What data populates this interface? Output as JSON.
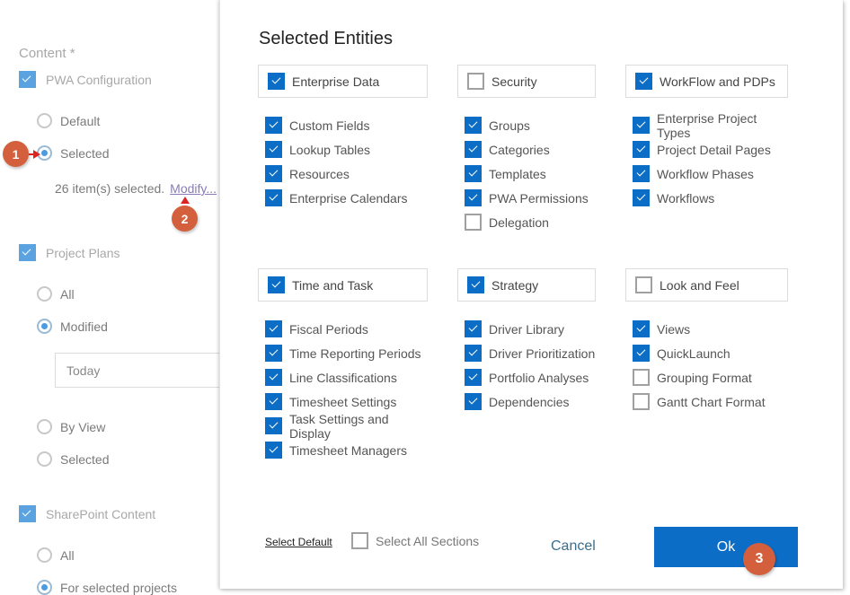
{
  "background": {
    "content_label": "Content *",
    "pwa_configuration": {
      "label": "PWA Configuration",
      "checked": true
    },
    "pwa_options": [
      {
        "label": "Default",
        "selected": false
      },
      {
        "label": "Selected",
        "selected": true
      }
    ],
    "items_selected_text": "26 item(s) selected.",
    "modify_link": "Modify...",
    "project_plans": {
      "label": "Project Plans",
      "checked": true
    },
    "project_options": [
      {
        "label": "All",
        "selected": false
      },
      {
        "label": "Modified",
        "selected": true
      }
    ],
    "modified_date_value": "Today",
    "project_options_more": [
      {
        "label": "By View",
        "selected": false
      },
      {
        "label": "Selected",
        "selected": false
      }
    ],
    "sharepoint_content": {
      "label": "SharePoint Content",
      "checked": true
    },
    "sharepoint_options": [
      {
        "label": "All",
        "selected": false
      },
      {
        "label": "For selected projects",
        "selected": true
      }
    ]
  },
  "callouts": [
    "1",
    "2",
    "3"
  ],
  "dialog": {
    "title": "Selected Entities",
    "groups": [
      {
        "label": "Enterprise Data",
        "checked": true,
        "items": [
          {
            "label": "Custom Fields",
            "checked": true
          },
          {
            "label": "Lookup Tables",
            "checked": true
          },
          {
            "label": "Resources",
            "checked": true
          },
          {
            "label": "Enterprise Calendars",
            "checked": true
          }
        ]
      },
      {
        "label": "Security",
        "checked": false,
        "items": [
          {
            "label": "Groups",
            "checked": true
          },
          {
            "label": "Categories",
            "checked": true
          },
          {
            "label": "Templates",
            "checked": true
          },
          {
            "label": "PWA Permissions",
            "checked": true
          },
          {
            "label": "Delegation",
            "checked": false
          }
        ]
      },
      {
        "label": "WorkFlow and PDPs",
        "checked": true,
        "items": [
          {
            "label": "Enterprise Project Types",
            "checked": true
          },
          {
            "label": "Project Detail Pages",
            "checked": true
          },
          {
            "label": "Workflow Phases",
            "checked": true
          },
          {
            "label": "Workflows",
            "checked": true
          }
        ]
      },
      {
        "label": "Time and Task",
        "checked": true,
        "items": [
          {
            "label": "Fiscal Periods",
            "checked": true
          },
          {
            "label": "Time Reporting Periods",
            "checked": true
          },
          {
            "label": "Line Classifications",
            "checked": true
          },
          {
            "label": "Timesheet Settings",
            "checked": true
          },
          {
            "label": "Task Settings and Display",
            "checked": true
          },
          {
            "label": "Timesheet Managers",
            "checked": true
          }
        ]
      },
      {
        "label": "Strategy",
        "checked": true,
        "items": [
          {
            "label": "Driver Library",
            "checked": true
          },
          {
            "label": "Driver Prioritization",
            "checked": true
          },
          {
            "label": "Portfolio Analyses",
            "checked": true
          },
          {
            "label": "Dependencies",
            "checked": true
          }
        ]
      },
      {
        "label": "Look and Feel",
        "checked": false,
        "items": [
          {
            "label": "Views",
            "checked": true
          },
          {
            "label": "QuickLaunch",
            "checked": true
          },
          {
            "label": "Grouping Format",
            "checked": false
          },
          {
            "label": "Gantt Chart Format",
            "checked": false
          }
        ]
      }
    ],
    "footer": {
      "select_default": "Select Default",
      "select_all_sections": {
        "label": "Select All Sections",
        "checked": false
      },
      "cancel": "Cancel",
      "ok": "Ok"
    }
  },
  "colors": {
    "accent": "#0c6dc6",
    "callout": "#d45f3c",
    "dim_checkbox": "#5aa3e0"
  }
}
